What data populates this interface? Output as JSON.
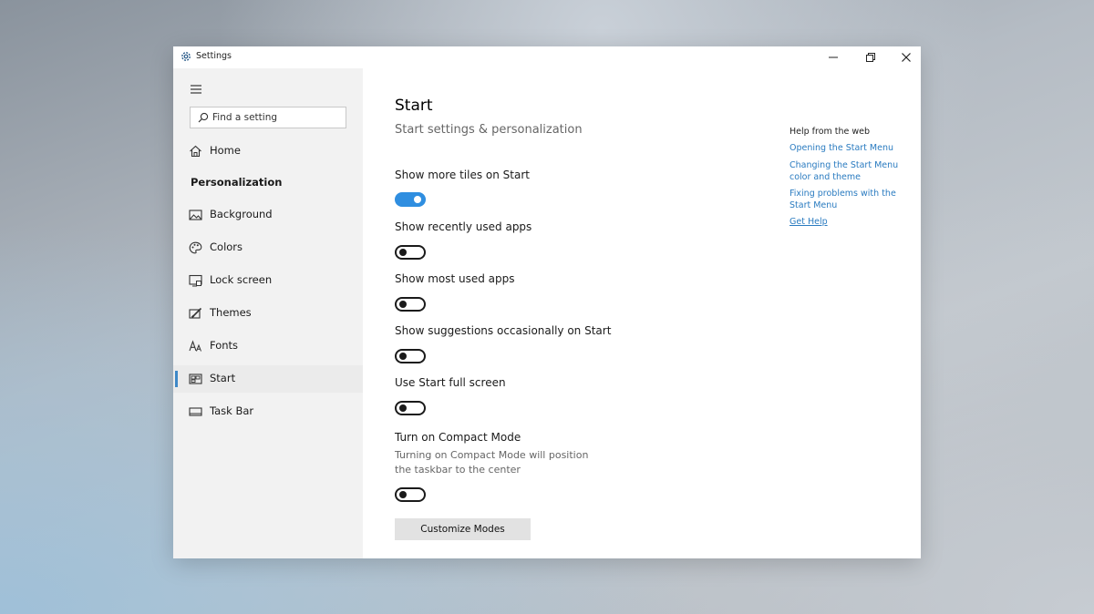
{
  "window": {
    "title": "Settings"
  },
  "sidebar": {
    "search_placeholder": "Find a setting",
    "home_label": "Home",
    "section_title": "Personalization",
    "items": [
      {
        "label": "Background",
        "icon": "picture-icon"
      },
      {
        "label": "Colors",
        "icon": "palette-icon"
      },
      {
        "label": "Lock screen",
        "icon": "lock-screen-icon"
      },
      {
        "label": "Themes",
        "icon": "brush-icon"
      },
      {
        "label": "Fonts",
        "icon": "font-icon"
      },
      {
        "label": "Start",
        "icon": "start-icon",
        "selected": true
      },
      {
        "label": "Task Bar",
        "icon": "taskbar-icon"
      }
    ]
  },
  "main": {
    "title": "Start",
    "subtitle": "Start settings & personalization",
    "settings": [
      {
        "label": "Show more tiles on Start",
        "on": true
      },
      {
        "label": "Show recently used apps",
        "on": false
      },
      {
        "label": "Show most used apps",
        "on": false
      },
      {
        "label": "Show suggestions occasionally on Start",
        "on": false
      },
      {
        "label": "Use Start full screen",
        "on": false
      },
      {
        "label": "Turn on Compact Mode",
        "description_line1": "Turning on Compact Mode will position",
        "description_line2": "the taskbar to the center",
        "on": false
      }
    ],
    "customize_button": "Customize Modes"
  },
  "help": {
    "title": "Help from the web",
    "links": [
      {
        "line1": "Opening the Start Menu",
        "line2": ""
      },
      {
        "line1": "Changing the Start Menu",
        "line2": "color and theme"
      },
      {
        "line1": "Fixing problems with the",
        "line2": "Start Menu"
      }
    ],
    "get_help": "Get Help"
  },
  "colors": {
    "accent": "#2f8ee0",
    "link": "#2a7bc0",
    "sidebar_bg": "#f2f2f2"
  }
}
